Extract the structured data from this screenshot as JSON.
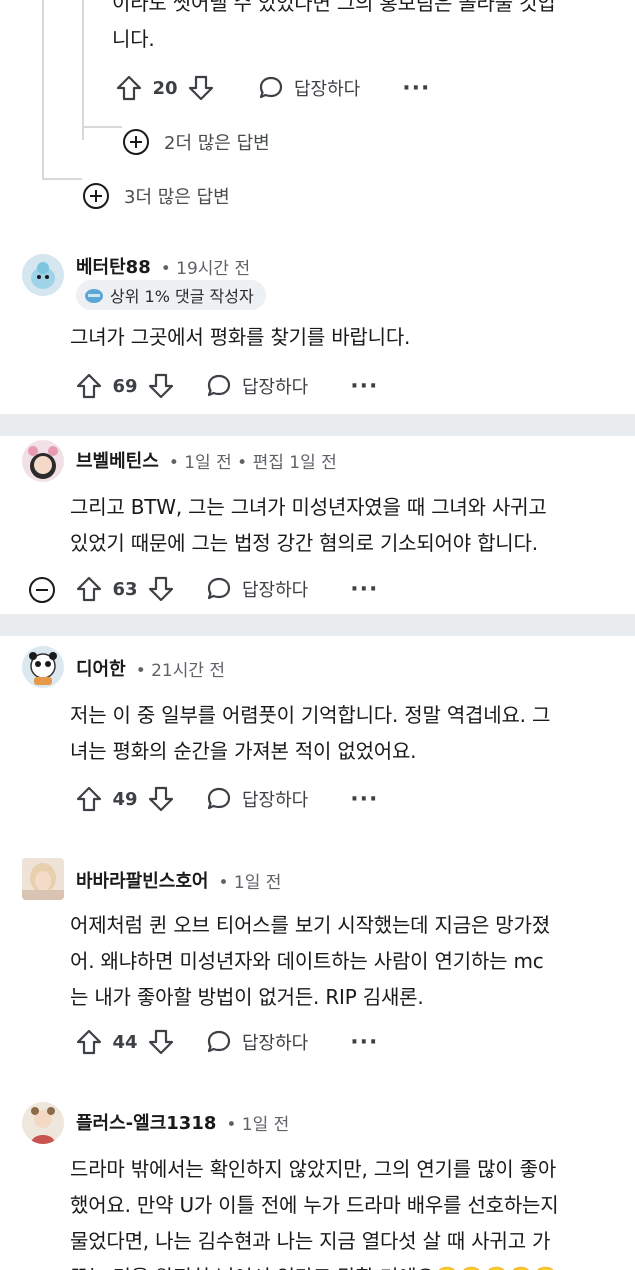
{
  "top_comment": {
    "text_lines": [
      "이라도 씻어낼 수 있었다면 그의 홍보팀은 놀라울 것입",
      "니다."
    ],
    "upvotes": "20",
    "reply_label": "답장하다",
    "more_icon": "ellipsis-icon"
  },
  "more_replies_nested": "2더 많은 답변",
  "more_replies_outer": "3더 많은 답변",
  "comments": [
    {
      "username": "베터탄88",
      "meta": "• 19시간 전",
      "badge": "상위 1% 댓글 작성자",
      "lines": [
        "그녀가 그곳에서 평화를 찾기를 바랍니다."
      ],
      "upvotes": "69",
      "reply_label": "답장하다"
    },
    {
      "username": "브벨베틴스",
      "meta": "• 1일 전 • 편집 1일 전",
      "lines": [
        "그리고 BTW, 그는 그녀가 미성년자였을 때 그녀와 사귀고",
        "있었기 때문에 그는 법정 강간 혐의로 기소되어야 합니다."
      ],
      "upvotes": "63",
      "reply_label": "답장하다"
    },
    {
      "username": "디어한",
      "meta": "• 21시간 전",
      "lines": [
        "저는 이 중 일부를 어렴풋이 기억합니다. 정말 역겹네요. 그",
        "녀는 평화의 순간을 가져본 적이 없었어요."
      ],
      "upvotes": "49",
      "reply_label": "답장하다"
    },
    {
      "username": "바바라팔빈스호어",
      "meta": "• 1일 전",
      "lines": [
        "어제처럼 퀸 오브 티어스를 보기 시작했는데 지금은 망가졌",
        "어. 왜냐하면 미성년자와 데이트하는 사람이 연기하는 mc",
        "는 내가 좋아할 방법이 없거든. RIP 김새론."
      ],
      "upvotes": "44",
      "reply_label": "답장하다"
    },
    {
      "username": "플러스-엘크1318",
      "meta": "• 1일 전",
      "lines": [
        "드라마 밖에서는 확인하지 않았지만, 그의 연기를 많이 좋아",
        "했어요. 만약 U가 이틀 전에 누가 드라마 배우를 선호하는지",
        "물었다면, 나는 김수현과 나는 지금 열다섯 살 때 사귀고 가",
        "꾸는 것을 완전히 넘어서 있다고 말할 거예요🤮🤮🤮🤮🤮"
      ]
    }
  ],
  "colors": {
    "thread_line": "#d7d9dc",
    "divider": "#eaedef",
    "text": "#1a1a1b",
    "meta": "#5f6368"
  }
}
